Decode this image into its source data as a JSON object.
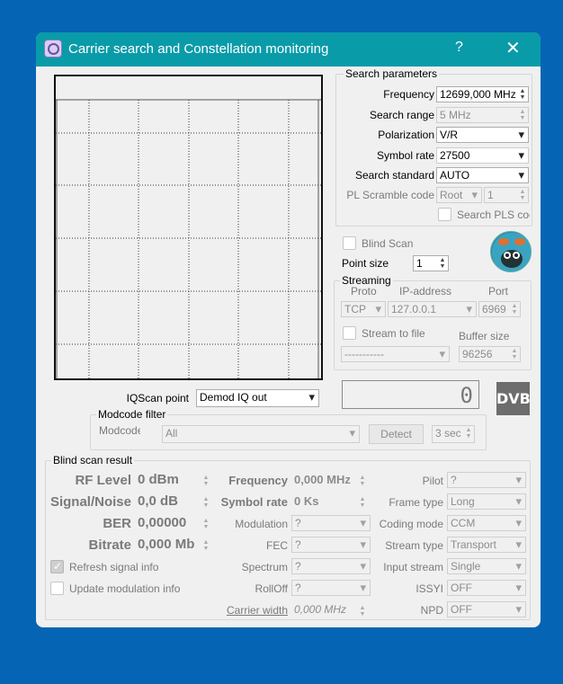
{
  "window": {
    "title": "Carrier search and Constellation monitoring",
    "help": "?",
    "close": "✕"
  },
  "search": {
    "group_title": "Search parameters",
    "frequency_label": "Frequency",
    "frequency_value": "12699,000 MHz",
    "range_label": "Search range",
    "range_value": "5 MHz",
    "polarization_label": "Polarization",
    "polarization_value": "V/R",
    "symbol_rate_label": "Symbol rate",
    "symbol_rate_value": "27500",
    "standard_label": "Search standard",
    "standard_value": "AUTO",
    "pl_label": "PL Scramble code",
    "pl_mode": "Root",
    "pl_value": "1",
    "search_pls_label": "Search PLS code"
  },
  "blind_scan_label": "Blind Scan",
  "point_size_label": "Point size",
  "point_size_value": "1",
  "streaming": {
    "group_title": "Streaming",
    "proto_label": "Proto",
    "ip_label": "IP-address",
    "port_label": "Port",
    "proto_value": "TCP",
    "ip_value": "127.0.0.1",
    "port_value": "6969",
    "stream_to_file_label": "Stream to file",
    "buffer_label": "Buffer size",
    "file_value": "-----------",
    "buffer_value": "96256"
  },
  "iqscan_label": "IQScan point",
  "iqscan_value": "Demod IQ out",
  "lcd_value": "0",
  "dvb_logo": "DVB",
  "modcode": {
    "group_title": "Modcode filter",
    "label": "Modcode",
    "value": "All",
    "detect": "Detect",
    "seconds": "3 sec"
  },
  "result": {
    "group_title": "Blind scan result",
    "rf_label": "RF Level",
    "rf_value": "0 dBm",
    "sn_label": "Signal/Noise",
    "sn_value": "0,0 dB",
    "ber_label": "BER",
    "ber_value": "0,00000",
    "bitrate_label": "Bitrate",
    "bitrate_value": "0,000 Mb",
    "freq_label": "Frequency",
    "freq_value": "0,000 MHz",
    "sr_label": "Symbol rate",
    "sr_value": "0 Ks",
    "modulation_label": "Modulation",
    "modulation_value": "?",
    "fec_label": "FEC",
    "fec_value": "?",
    "spectrum_label": "Spectrum",
    "spectrum_value": "?",
    "rolloff_label": "RollOff",
    "rolloff_value": "?",
    "carrier_width_label": "Carrier width",
    "carrier_width_value": "0,000 MHz",
    "pilot_label": "Pilot",
    "pilot_value": "?",
    "frame_label": "Frame type",
    "frame_value": "Long",
    "coding_label": "Coding mode",
    "coding_value": "CCM",
    "stream_type_label": "Stream type",
    "stream_type_value": "Transport",
    "input_stream_label": "Input stream",
    "input_stream_value": "Single",
    "issyi_label": "ISSYI",
    "issyi_value": "OFF",
    "npd_label": "NPD",
    "npd_value": "OFF",
    "refresh_label": "Refresh signal info",
    "update_label": "Update modulation info"
  }
}
